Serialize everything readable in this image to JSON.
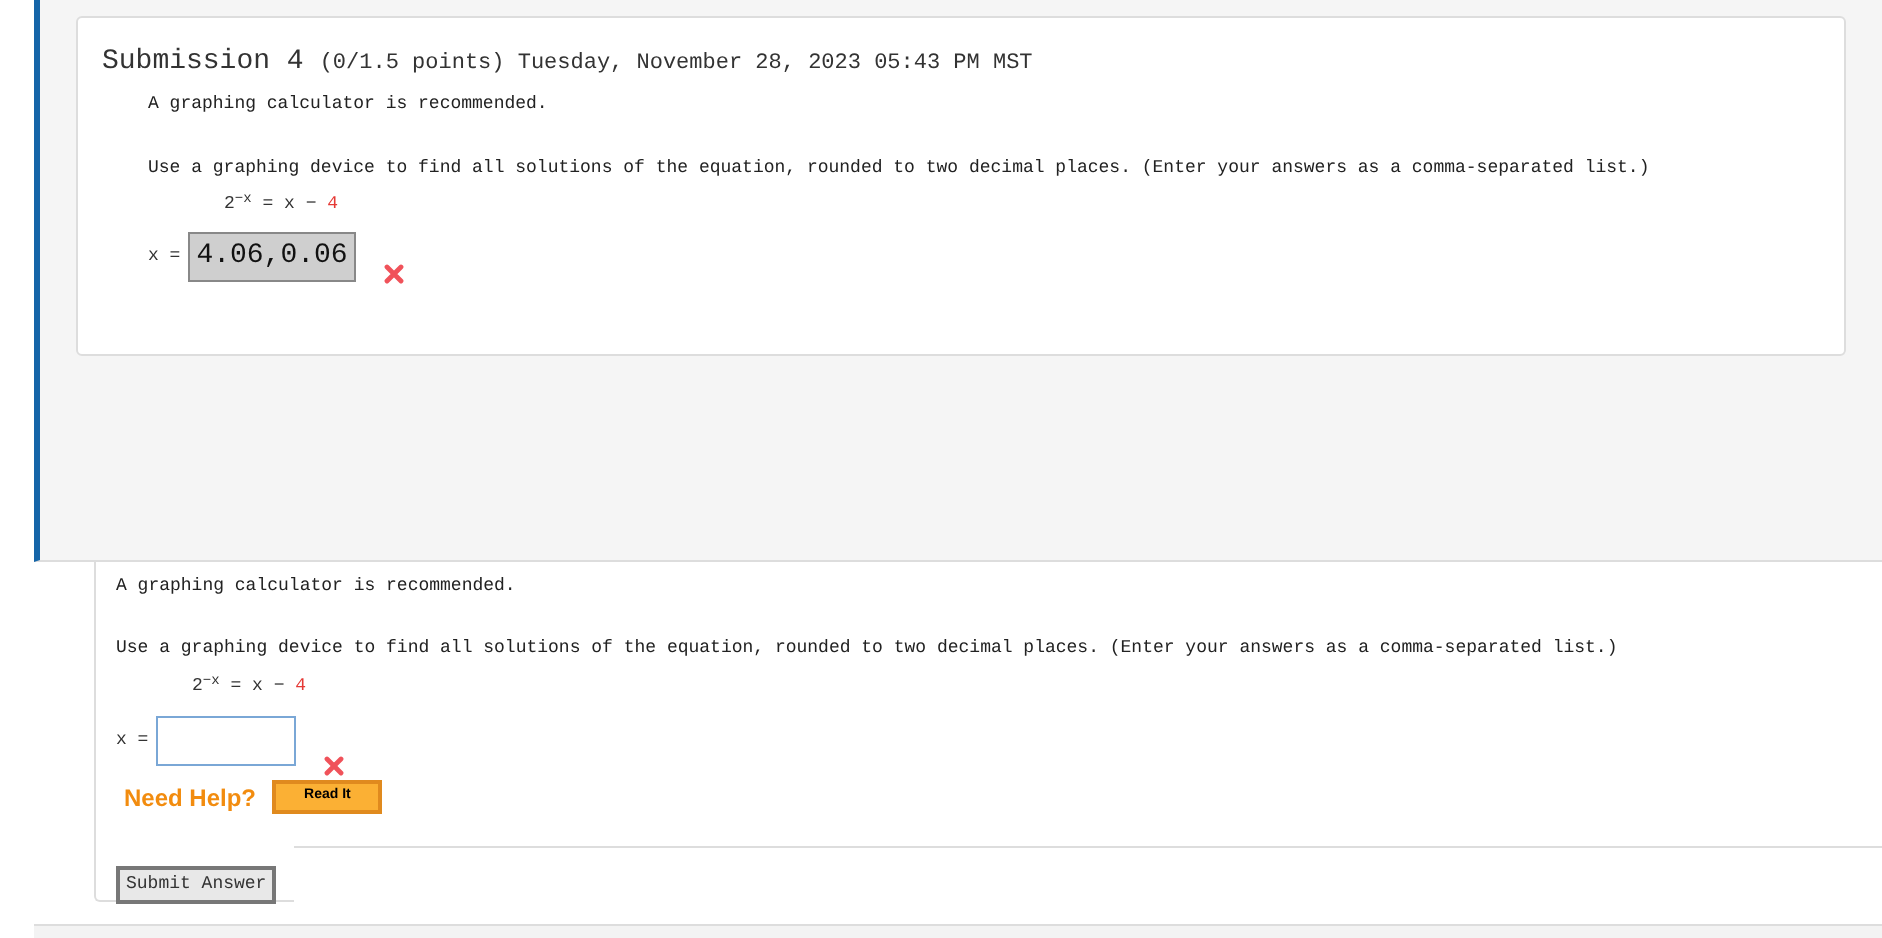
{
  "submission": {
    "title": "Submission 4",
    "meta": "(0/1.5 points) Tuesday, November 28, 2023 05:43 PM MST",
    "note": "A graphing calculator is recommended.",
    "instruction": "Use a graphing device to find all solutions of the equation, rounded to two decimal places. (Enter your answers as a comma-separated list.)",
    "equation": {
      "base": "2",
      "exponent": "−x",
      "rhs": "= x −",
      "constant": "4"
    },
    "answer_label": "x =",
    "answer": "4.06,0.06",
    "correct": false
  },
  "question": {
    "note": "A graphing calculator is recommended.",
    "instruction": "Use a graphing device to find all solutions of the equation, rounded to two decimal places. (Enter your answers as a comma-separated list.)",
    "equation": {
      "base": "2",
      "exponent": "−x",
      "rhs": "= x −",
      "constant": "4"
    },
    "answer_label": "x =",
    "correct": false,
    "help_label": "Need Help?",
    "help_button": "Read It",
    "submit_button": "Submit Answer"
  }
}
